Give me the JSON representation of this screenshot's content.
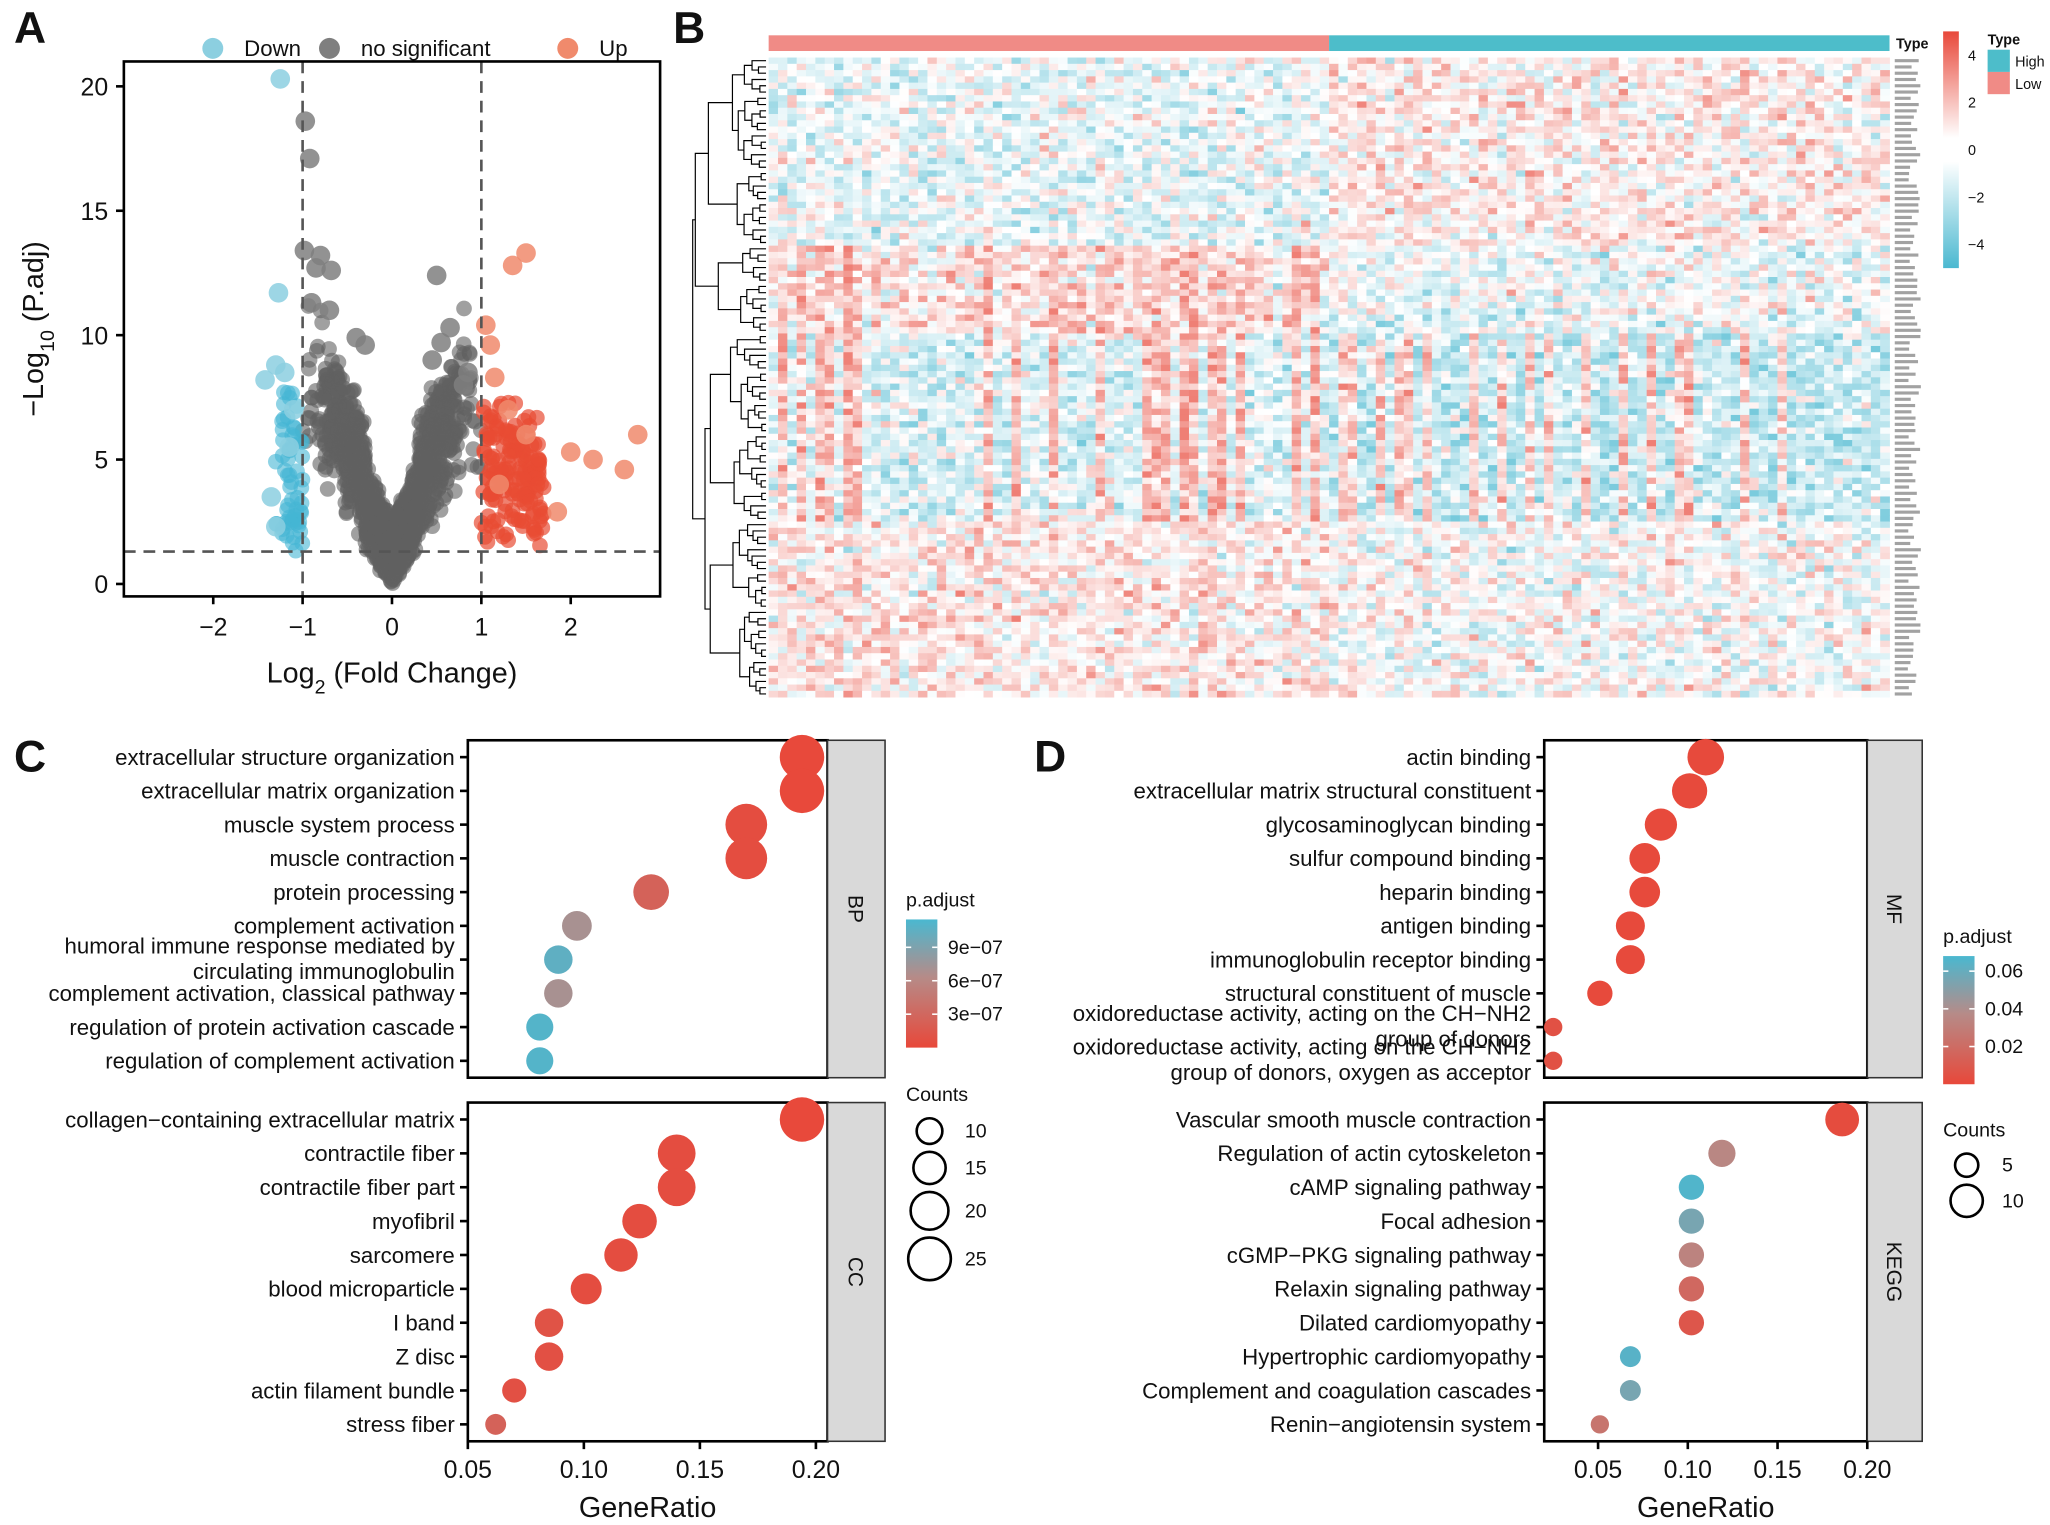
{
  "chart_data": [
    {
      "panel": "A",
      "type": "scatter",
      "title": "",
      "xlabel": "Log2 (Fold Change)",
      "ylabel": "-Log10 (P.adj)",
      "xlim": [
        -3,
        3
      ],
      "ylim": [
        -0.5,
        21
      ],
      "xticks": [
        -2,
        -1,
        0,
        1,
        2
      ],
      "yticks": [
        0,
        5,
        10,
        15,
        20
      ],
      "thresholds": {
        "logfc": [
          -1,
          1
        ],
        "neglog10_padj": 1.3
      },
      "legend": {
        "position": "top",
        "entries": [
          {
            "name": "Down",
            "color": "#8ccfe0"
          },
          {
            "name": "no significant",
            "color": "#7f7f7f"
          },
          {
            "name": "Up",
            "color": "#f08a6c"
          }
        ]
      },
      "highlight_points": {
        "Down": [
          [
            -1.25,
            20.3
          ],
          [
            -1.27,
            11.7
          ],
          [
            -1.42,
            8.2
          ],
          [
            -1.3,
            8.8
          ],
          [
            -1.2,
            8.5
          ],
          [
            -1.35,
            3.5
          ],
          [
            -1.3,
            2.3
          ],
          [
            -1.1,
            7.0
          ],
          [
            -1.15,
            5.5
          ]
        ],
        "no significant": [
          [
            -0.97,
            18.6
          ],
          [
            -0.92,
            17.1
          ],
          [
            -0.98,
            13.4
          ],
          [
            -0.8,
            13.2
          ],
          [
            -0.85,
            12.7
          ],
          [
            -0.68,
            12.6
          ],
          [
            -0.9,
            11.3
          ],
          [
            -0.7,
            11.0
          ],
          [
            0.5,
            12.4
          ],
          [
            0.55,
            9.7
          ],
          [
            0.65,
            10.3
          ],
          [
            0.45,
            9.0
          ],
          [
            0.85,
            8.5
          ],
          [
            0.8,
            8.0
          ],
          [
            -0.4,
            9.9
          ],
          [
            -0.3,
            9.6
          ]
        ],
        "Up": [
          [
            1.5,
            13.3
          ],
          [
            1.35,
            12.8
          ],
          [
            1.05,
            10.4
          ],
          [
            1.1,
            9.6
          ],
          [
            1.15,
            8.3
          ],
          [
            2.75,
            6.0
          ],
          [
            2.0,
            5.3
          ],
          [
            2.25,
            5.0
          ],
          [
            2.6,
            4.6
          ],
          [
            1.85,
            2.9
          ],
          [
            1.3,
            7.0
          ],
          [
            1.5,
            6.0
          ],
          [
            1.2,
            4.0
          ]
        ]
      },
      "bulk_groups": {
        "no significant": {
          "x_range": [
            -1,
            1
          ],
          "y_max": 9
        },
        "Down": {
          "x_range": [
            -1.3,
            -1
          ],
          "y_max": 8
        },
        "Up": {
          "x_range": [
            1,
            1.7
          ],
          "y_max": 8
        }
      }
    },
    {
      "panel": "B",
      "type": "heatmap",
      "annotation": {
        "title": "Type",
        "groups": [
          {
            "name": "Low",
            "color": "#f08b86",
            "fraction": 0.5
          },
          {
            "name": "High",
            "color": "#4dbdca",
            "fraction": 0.5
          }
        ]
      },
      "colorbar": {
        "ticks": [
          4,
          2,
          0,
          -2,
          -4
        ],
        "range": [
          -5,
          5
        ],
        "low_color": "#4ab8d0",
        "mid_color": "#ffffff",
        "high_color": "#e8483a"
      },
      "legend_title": "Type",
      "legend_entries": [
        {
          "name": "High",
          "color": "#4dbdca"
        },
        {
          "name": "Low",
          "color": "#f08b86"
        }
      ],
      "row_clusters": [
        {
          "rows": 30,
          "pattern": "mixed"
        },
        {
          "rows": 14,
          "pattern": "low-high-up"
        },
        {
          "rows": 30,
          "pattern": "low-high-up-strong"
        },
        {
          "rows": 28,
          "pattern": "mixed"
        }
      ],
      "columns": 240
    },
    {
      "panel": "C",
      "type": "scatter",
      "xlabel": "GeneRatio",
      "xlim": [
        0.05,
        0.205
      ],
      "xticks": [
        "0.05",
        "0.10",
        "0.15",
        "0.20"
      ],
      "legend_color": {
        "title": "p.adjust",
        "ticks": [
          "9e-07",
          "6e-07",
          "3e-07"
        ],
        "range": [
          0,
          1.15e-06
        ]
      },
      "legend_size": {
        "title": "Counts",
        "values": [
          10,
          15,
          20,
          25
        ]
      },
      "facets": [
        {
          "name": "BP",
          "terms": [
            {
              "label": "extracellular structure organization",
              "ratio": 0.194,
              "count": 27,
              "padj": 5e-09
            },
            {
              "label": "extracellular matrix organization",
              "ratio": 0.194,
              "count": 27,
              "padj": 5e-09
            },
            {
              "label": "muscle system process",
              "ratio": 0.17,
              "count": 24,
              "padj": 5e-08
            },
            {
              "label": "muscle contraction",
              "ratio": 0.17,
              "count": 24,
              "padj": 5e-08
            },
            {
              "label": "protein processing",
              "ratio": 0.129,
              "count": 18,
              "padj": 2.5e-07
            },
            {
              "label": "complement activation",
              "ratio": 0.097,
              "count": 13,
              "padj": 7e-07
            },
            {
              "label": "humoral immune response mediated by\ncirculating immunoglobulin",
              "ratio": 0.089,
              "count": 12,
              "padj": 1.05e-06
            },
            {
              "label": "complement activation, classical pathway",
              "ratio": 0.089,
              "count": 12,
              "padj": 7e-07
            },
            {
              "label": "regulation of protein activation cascade",
              "ratio": 0.081,
              "count": 11,
              "padj": 1.1e-06
            },
            {
              "label": "regulation of complement activation",
              "ratio": 0.081,
              "count": 11,
              "padj": 1.1e-06
            }
          ]
        },
        {
          "name": "CC",
          "terms": [
            {
              "label": "collagen-containing extracellular matrix",
              "ratio": 0.194,
              "count": 27,
              "padj": 5e-09
            },
            {
              "label": "contractile fiber",
              "ratio": 0.14,
              "count": 20,
              "padj": 5e-08
            },
            {
              "label": "contractile fiber part",
              "ratio": 0.14,
              "count": 20,
              "padj": 5e-08
            },
            {
              "label": "myofibril",
              "ratio": 0.124,
              "count": 17,
              "padj": 5e-08
            },
            {
              "label": "sarcomere",
              "ratio": 0.116,
              "count": 16,
              "padj": 5e-08
            },
            {
              "label": "blood microparticle",
              "ratio": 0.101,
              "count": 14,
              "padj": 5e-08
            },
            {
              "label": "I band",
              "ratio": 0.085,
              "count": 12,
              "padj": 1e-07
            },
            {
              "label": "Z disc",
              "ratio": 0.085,
              "count": 12,
              "padj": 8e-08
            },
            {
              "label": "actin filament bundle",
              "ratio": 0.07,
              "count": 9,
              "padj": 8e-08
            },
            {
              "label": "stress fiber",
              "ratio": 0.062,
              "count": 7,
              "padj": 2.5e-07
            }
          ]
        }
      ]
    },
    {
      "panel": "D",
      "type": "scatter",
      "xlabel": "GeneRatio",
      "xlim": [
        0.02,
        0.2
      ],
      "xticks": [
        "0.05",
        "0.10",
        "0.15",
        "0.20"
      ],
      "legend_color": {
        "title": "p.adjust",
        "ticks": [
          "0.06",
          "0.04",
          "0.02"
        ],
        "range": [
          0,
          0.068
        ]
      },
      "legend_size": {
        "title": "Counts",
        "values": [
          5,
          10
        ]
      },
      "facets": [
        {
          "name": "MF",
          "terms": [
            {
              "label": "actin binding",
              "ratio": 0.11,
              "count": 13,
              "padj": 0.001
            },
            {
              "label": "extracellular matrix structural constituent",
              "ratio": 0.101,
              "count": 12,
              "padj": 0.001
            },
            {
              "label": "glycosaminoglycan binding",
              "ratio": 0.085,
              "count": 10,
              "padj": 0.001
            },
            {
              "label": "sulfur compound binding",
              "ratio": 0.076,
              "count": 9,
              "padj": 0.001
            },
            {
              "label": "heparin binding",
              "ratio": 0.076,
              "count": 9,
              "padj": 0.001
            },
            {
              "label": "antigen binding",
              "ratio": 0.068,
              "count": 8,
              "padj": 0.001
            },
            {
              "label": "immunoglobulin receptor binding",
              "ratio": 0.068,
              "count": 8,
              "padj": 0.001
            },
            {
              "label": "structural constituent of muscle",
              "ratio": 0.051,
              "count": 6,
              "padj": 0.001
            },
            {
              "label": "oxidoreductase activity, acting on the CH-NH2\ngroup of donors",
              "ratio": 0.025,
              "count": 3,
              "padj": 0.005
            },
            {
              "label": "oxidoreductase activity, acting on the CH-NH2\ngroup of donors, oxygen as acceptor",
              "ratio": 0.025,
              "count": 3,
              "padj": 0.005
            }
          ]
        },
        {
          "name": "KEGG",
          "terms": [
            {
              "label": "Vascular smooth muscle contraction",
              "ratio": 0.186,
              "count": 11,
              "padj": 0.002
            },
            {
              "label": "Regulation of actin cytoskeleton",
              "ratio": 0.119,
              "count": 7,
              "padj": 0.035
            },
            {
              "label": "cAMP signaling pathway",
              "ratio": 0.102,
              "count": 6,
              "padj": 0.066
            },
            {
              "label": "Focal adhesion",
              "ratio": 0.102,
              "count": 6,
              "padj": 0.055
            },
            {
              "label": "cGMP-PKG signaling pathway",
              "ratio": 0.102,
              "count": 6,
              "padj": 0.033
            },
            {
              "label": "Relaxin signaling pathway",
              "ratio": 0.102,
              "count": 6,
              "padj": 0.018
            },
            {
              "label": "Dilated cardiomyopathy",
              "ratio": 0.102,
              "count": 6,
              "padj": 0.008
            },
            {
              "label": "Hypertrophic cardiomyopathy",
              "ratio": 0.068,
              "count": 4,
              "padj": 0.064
            },
            {
              "label": "Complement and coagulation cascades",
              "ratio": 0.068,
              "count": 4,
              "padj": 0.055
            },
            {
              "label": "Renin-angiotensin system",
              "ratio": 0.051,
              "count": 3,
              "padj": 0.025
            }
          ]
        }
      ]
    }
  ],
  "panels": {
    "a": {
      "letter": "A"
    },
    "b": {
      "letter": "B"
    },
    "c": {
      "letter": "C"
    },
    "d": {
      "letter": "D"
    }
  }
}
